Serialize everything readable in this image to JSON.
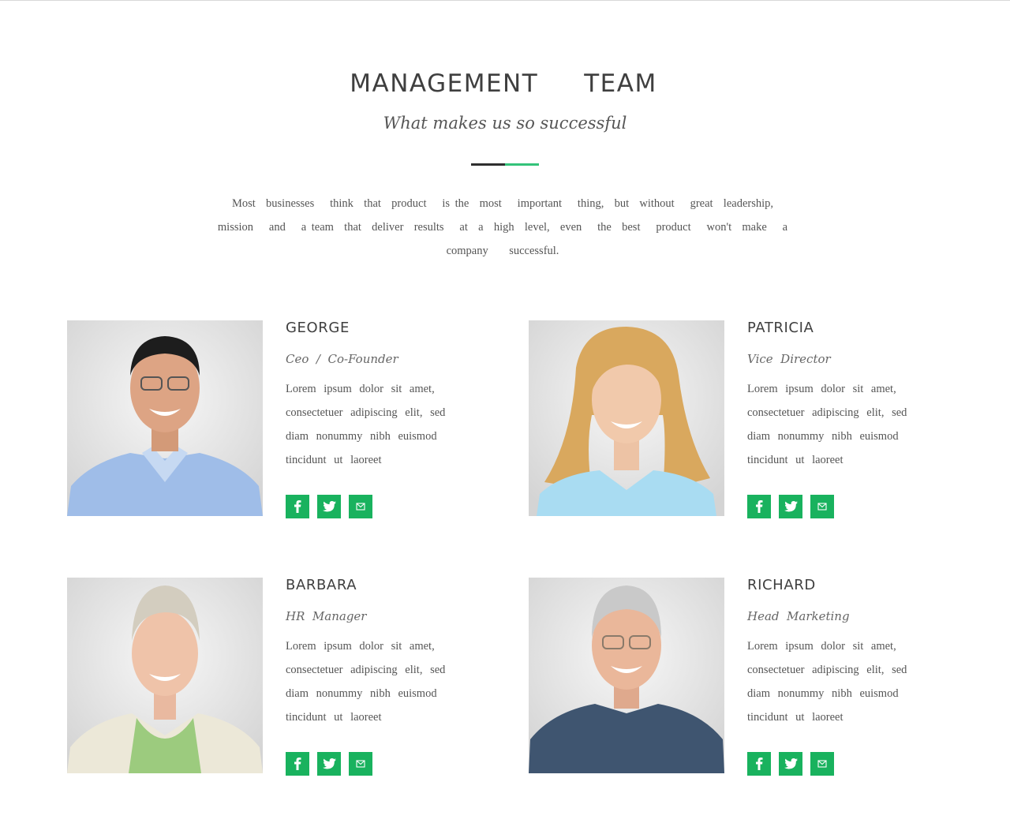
{
  "section": {
    "title": "MANAGEMENT   TEAM",
    "subtitle": "What makes us so successful",
    "intro": "Most  businesses   think  that  product   is the  most   important   thing,  but  without   great  leadership,   mission   and   a team  that  deliver  results   at  a  high  level,  even   the  best   product   won't  make   a  company    successful.",
    "accent_color": "#34c37a",
    "social_color": "#19b25e"
  },
  "team": [
    {
      "name": "GEORGE",
      "role": "Ceo  /  Co-Founder",
      "bio": "Lorem  ipsum  dolor  sit  amet, consectetuer    adipiscing   elit,  sed diam  nonummy   nibh  euismod tincidunt   ut  laoreet",
      "socials": [
        "facebook-icon",
        "twitter-icon",
        "email-icon"
      ]
    },
    {
      "name": "PATRICIA",
      "role": "Vice  Director",
      "bio": "Lorem  ipsum  dolor  sit  amet, consectetuer    adipiscing   elit,  sed diam  nonummy   nibh  euismod tincidunt   ut  laoreet",
      "socials": [
        "facebook-icon",
        "twitter-icon",
        "email-icon"
      ]
    },
    {
      "name": "BARBARA",
      "role": "HR  Manager",
      "bio": "Lorem  ipsum  dolor  sit  amet, consectetuer    adipiscing   elit,  sed diam  nonummy   nibh  euismod tincidunt   ut  laoreet",
      "socials": [
        "facebook-icon",
        "twitter-icon",
        "email-icon"
      ]
    },
    {
      "name": "RICHARD",
      "role": "Head  Marketing",
      "bio": "Lorem  ipsum  dolor  sit  amet, consectetuer    adipiscing   elit,  sed diam  nonummy   nibh  euismod tincidunt   ut  laoreet",
      "socials": [
        "facebook-icon",
        "twitter-icon",
        "email-icon"
      ]
    }
  ]
}
